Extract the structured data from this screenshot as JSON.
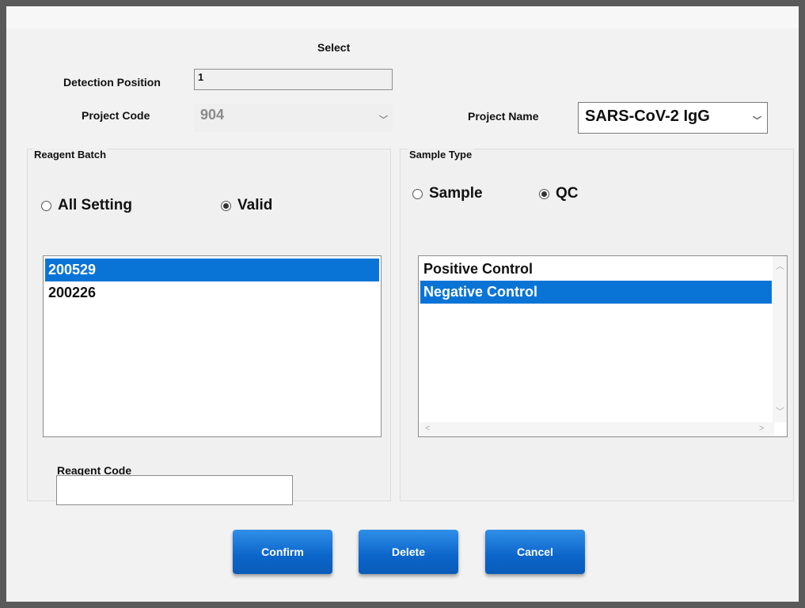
{
  "dialog": {
    "title": "Select",
    "detection_position_label": "Detection Position",
    "detection_position_value": "1",
    "project_code_label": "Project Code",
    "project_code_value": "904",
    "project_name_label": "Project Name",
    "project_name_value": "SARS-CoV-2 IgG"
  },
  "reagent_batch": {
    "title": "Reagent Batch",
    "radio_all": "All Setting",
    "radio_valid": "Valid",
    "selected_radio": "Valid",
    "items": [
      {
        "label": "200529",
        "selected": true
      },
      {
        "label": "200226",
        "selected": false
      }
    ],
    "reagent_code_label": "Reagent Code",
    "reagent_code_value": ""
  },
  "sample_type": {
    "title": "Sample Type",
    "radio_sample": "Sample",
    "radio_qc": "QC",
    "selected_radio": "QC",
    "items": [
      {
        "label": "Positive Control",
        "selected": false
      },
      {
        "label": "Negative Control",
        "selected": true
      }
    ]
  },
  "buttons": {
    "confirm": "Confirm",
    "delete": "Delete",
    "cancel": "Cancel"
  },
  "colors": {
    "selection": "#0a74d6",
    "button": "#0b65c9"
  },
  "icons": {
    "dropdown": "chevron-down-icon",
    "scroll_up": "chevron-up-icon",
    "scroll_down": "chevron-down-icon",
    "scroll_left": "chevron-left-icon",
    "scroll_right": "chevron-right-icon"
  }
}
